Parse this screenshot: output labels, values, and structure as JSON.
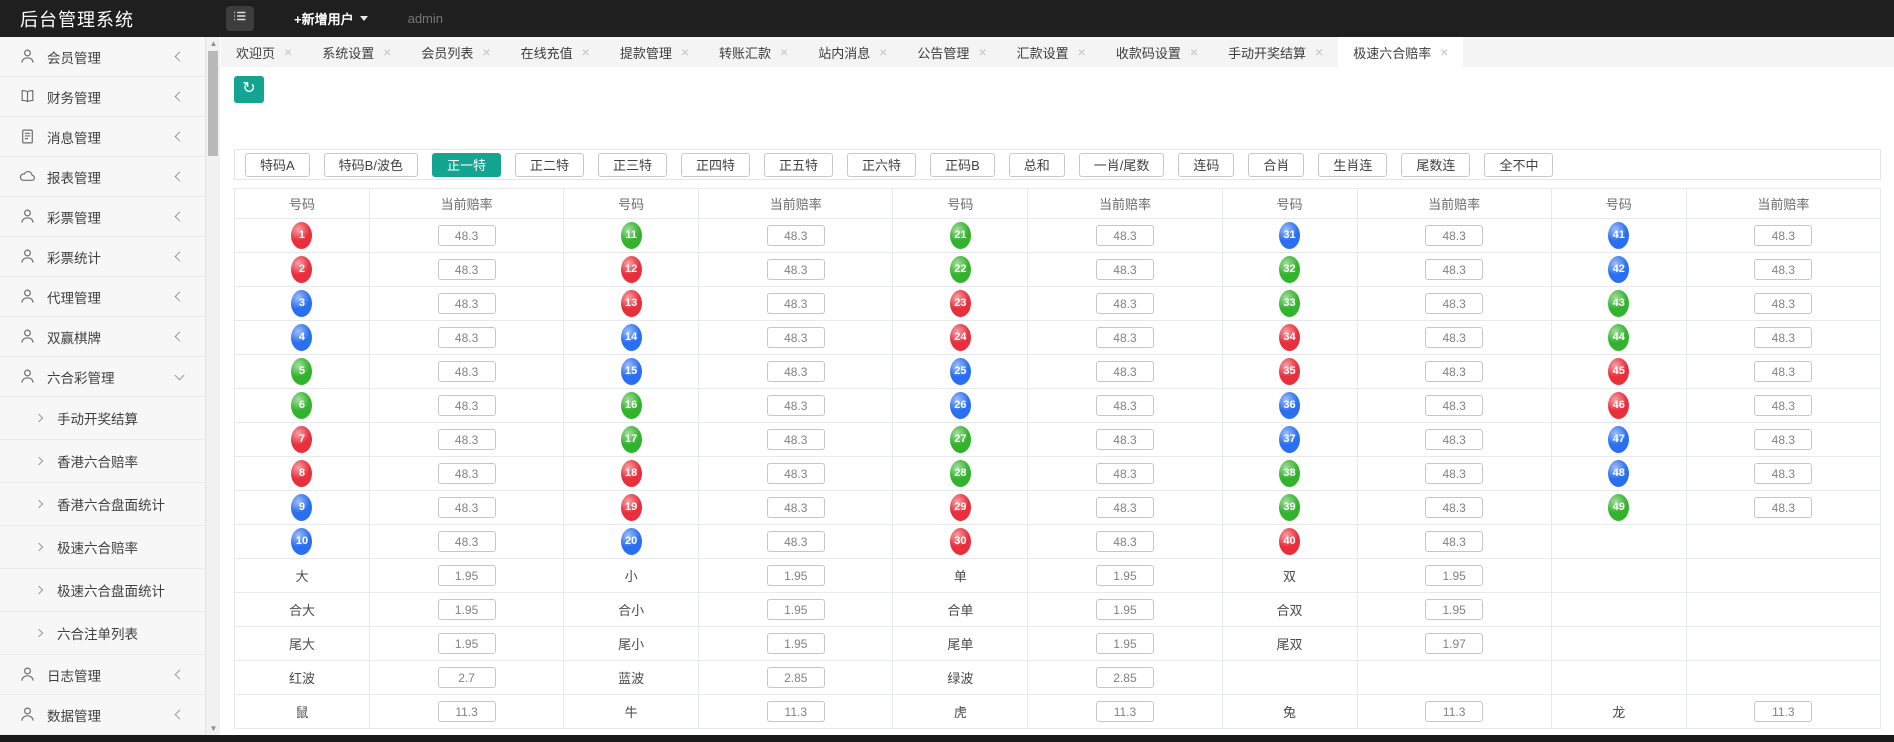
{
  "topbar": {
    "title": "后台管理系统",
    "menu_icon": "list-icon",
    "new_user_label": "+新增用户",
    "username": "admin"
  },
  "colors": {
    "accent_teal": "#14a492",
    "topbar_bg": "#1f1f1f",
    "ball_red": "#e82f3c",
    "ball_blue": "#2a6ff0",
    "ball_green": "#33b32d"
  },
  "sidebar": {
    "items": [
      {
        "icon": "user-icon",
        "label": "会员管理",
        "chevron": "left"
      },
      {
        "icon": "book-icon",
        "label": "财务管理",
        "chevron": "left"
      },
      {
        "icon": "file-icon",
        "label": "消息管理",
        "chevron": "left"
      },
      {
        "icon": "cloud-icon",
        "label": "报表管理",
        "chevron": "left"
      },
      {
        "icon": "user-icon",
        "label": "彩票管理",
        "chevron": "left"
      },
      {
        "icon": "user-icon",
        "label": "彩票统计",
        "chevron": "left"
      },
      {
        "icon": "user-icon",
        "label": "代理管理",
        "chevron": "left"
      },
      {
        "icon": "user-icon",
        "label": "双赢棋牌",
        "chevron": "left"
      },
      {
        "icon": "user-icon",
        "label": "六合彩管理",
        "chevron": "down",
        "children": [
          "手动开奖结算",
          "香港六合赔率",
          "香港六合盘面统计",
          "极速六合赔率",
          "极速六合盘面统计",
          "六合注单列表"
        ]
      },
      {
        "icon": "user-icon",
        "label": "日志管理",
        "chevron": "left"
      },
      {
        "icon": "user-icon",
        "label": "数据管理",
        "chevron": "left"
      }
    ]
  },
  "tabs": {
    "items": [
      {
        "label": "欢迎页",
        "active": false
      },
      {
        "label": "系统设置",
        "active": false
      },
      {
        "label": "会员列表",
        "active": false
      },
      {
        "label": "在线充值",
        "active": false
      },
      {
        "label": "提款管理",
        "active": false
      },
      {
        "label": "转账汇款",
        "active": false
      },
      {
        "label": "站内消息",
        "active": false
      },
      {
        "label": "公告管理",
        "active": false
      },
      {
        "label": "汇款设置",
        "active": false
      },
      {
        "label": "收款码设置",
        "active": false
      },
      {
        "label": "手动开奖结算",
        "active": false
      },
      {
        "label": "极速六合赔率",
        "active": true
      }
    ],
    "close_glyph": "×"
  },
  "toolbar": {
    "refresh_icon": "↻"
  },
  "filters": {
    "items": [
      {
        "label": "特码A",
        "active": false
      },
      {
        "label": "特码B/波色",
        "active": false
      },
      {
        "label": "正一特",
        "active": true
      },
      {
        "label": "正二特",
        "active": false
      },
      {
        "label": "正三特",
        "active": false
      },
      {
        "label": "正四特",
        "active": false
      },
      {
        "label": "正五特",
        "active": false
      },
      {
        "label": "正六特",
        "active": false
      },
      {
        "label": "正码B",
        "active": false
      },
      {
        "label": "总和",
        "active": false
      },
      {
        "label": "一肖/尾数",
        "active": false
      },
      {
        "label": "连码",
        "active": false
      },
      {
        "label": "合肖",
        "active": false
      },
      {
        "label": "生肖连",
        "active": false
      },
      {
        "label": "尾数连",
        "active": false
      },
      {
        "label": "全不中",
        "active": false
      }
    ]
  },
  "table": {
    "col_header_number": "号码",
    "col_header_odds": "当前赔率",
    "groups": 5,
    "rows": [
      {
        "cells": [
          {
            "ball": "1",
            "color": "red",
            "odds": "48.3"
          },
          {
            "ball": "11",
            "color": "green",
            "odds": "48.3"
          },
          {
            "ball": "21",
            "color": "green",
            "odds": "48.3"
          },
          {
            "ball": "31",
            "color": "blue",
            "odds": "48.3"
          },
          {
            "ball": "41",
            "color": "blue",
            "odds": "48.3"
          }
        ]
      },
      {
        "cells": [
          {
            "ball": "2",
            "color": "red",
            "odds": "48.3"
          },
          {
            "ball": "12",
            "color": "red",
            "odds": "48.3"
          },
          {
            "ball": "22",
            "color": "green",
            "odds": "48.3"
          },
          {
            "ball": "32",
            "color": "green",
            "odds": "48.3"
          },
          {
            "ball": "42",
            "color": "blue",
            "odds": "48.3"
          }
        ]
      },
      {
        "cells": [
          {
            "ball": "3",
            "color": "blue",
            "odds": "48.3"
          },
          {
            "ball": "13",
            "color": "red",
            "odds": "48.3"
          },
          {
            "ball": "23",
            "color": "red",
            "odds": "48.3"
          },
          {
            "ball": "33",
            "color": "green",
            "odds": "48.3"
          },
          {
            "ball": "43",
            "color": "green",
            "odds": "48.3"
          }
        ]
      },
      {
        "cells": [
          {
            "ball": "4",
            "color": "blue",
            "odds": "48.3"
          },
          {
            "ball": "14",
            "color": "blue",
            "odds": "48.3"
          },
          {
            "ball": "24",
            "color": "red",
            "odds": "48.3"
          },
          {
            "ball": "34",
            "color": "red",
            "odds": "48.3"
          },
          {
            "ball": "44",
            "color": "green",
            "odds": "48.3"
          }
        ]
      },
      {
        "cells": [
          {
            "ball": "5",
            "color": "green",
            "odds": "48.3"
          },
          {
            "ball": "15",
            "color": "blue",
            "odds": "48.3"
          },
          {
            "ball": "25",
            "color": "blue",
            "odds": "48.3"
          },
          {
            "ball": "35",
            "color": "red",
            "odds": "48.3"
          },
          {
            "ball": "45",
            "color": "red",
            "odds": "48.3"
          }
        ]
      },
      {
        "cells": [
          {
            "ball": "6",
            "color": "green",
            "odds": "48.3"
          },
          {
            "ball": "16",
            "color": "green",
            "odds": "48.3"
          },
          {
            "ball": "26",
            "color": "blue",
            "odds": "48.3"
          },
          {
            "ball": "36",
            "color": "blue",
            "odds": "48.3"
          },
          {
            "ball": "46",
            "color": "red",
            "odds": "48.3"
          }
        ]
      },
      {
        "cells": [
          {
            "ball": "7",
            "color": "red",
            "odds": "48.3"
          },
          {
            "ball": "17",
            "color": "green",
            "odds": "48.3"
          },
          {
            "ball": "27",
            "color": "green",
            "odds": "48.3"
          },
          {
            "ball": "37",
            "color": "blue",
            "odds": "48.3"
          },
          {
            "ball": "47",
            "color": "blue",
            "odds": "48.3"
          }
        ]
      },
      {
        "cells": [
          {
            "ball": "8",
            "color": "red",
            "odds": "48.3"
          },
          {
            "ball": "18",
            "color": "red",
            "odds": "48.3"
          },
          {
            "ball": "28",
            "color": "green",
            "odds": "48.3"
          },
          {
            "ball": "38",
            "color": "green",
            "odds": "48.3"
          },
          {
            "ball": "48",
            "color": "blue",
            "odds": "48.3"
          }
        ]
      },
      {
        "cells": [
          {
            "ball": "9",
            "color": "blue",
            "odds": "48.3"
          },
          {
            "ball": "19",
            "color": "red",
            "odds": "48.3"
          },
          {
            "ball": "29",
            "color": "red",
            "odds": "48.3"
          },
          {
            "ball": "39",
            "color": "green",
            "odds": "48.3"
          },
          {
            "ball": "49",
            "color": "green",
            "odds": "48.3"
          }
        ]
      },
      {
        "cells": [
          {
            "ball": "10",
            "color": "blue",
            "odds": "48.3"
          },
          {
            "ball": "20",
            "color": "blue",
            "odds": "48.3"
          },
          {
            "ball": "30",
            "color": "red",
            "odds": "48.3"
          },
          {
            "ball": "40",
            "color": "red",
            "odds": "48.3"
          },
          null
        ]
      },
      {
        "cells": [
          {
            "label": "大",
            "odds": "1.95"
          },
          {
            "label": "小",
            "odds": "1.95"
          },
          {
            "label": "单",
            "odds": "1.95"
          },
          {
            "label": "双",
            "odds": "1.95"
          },
          null
        ]
      },
      {
        "cells": [
          {
            "label": "合大",
            "odds": "1.95"
          },
          {
            "label": "合小",
            "odds": "1.95"
          },
          {
            "label": "合单",
            "odds": "1.95"
          },
          {
            "label": "合双",
            "odds": "1.95"
          },
          null
        ]
      },
      {
        "cells": [
          {
            "label": "尾大",
            "odds": "1.95"
          },
          {
            "label": "尾小",
            "odds": "1.95"
          },
          {
            "label": "尾单",
            "odds": "1.95"
          },
          {
            "label": "尾双",
            "odds": "1.97"
          },
          null
        ]
      },
      {
        "cells": [
          {
            "label": "红波",
            "odds": "2.7"
          },
          {
            "label": "蓝波",
            "odds": "2.85"
          },
          {
            "label": "绿波",
            "odds": "2.85"
          },
          null,
          null
        ]
      },
      {
        "cells": [
          {
            "label": "鼠",
            "odds": "11.3"
          },
          {
            "label": "牛",
            "odds": "11.3"
          },
          {
            "label": "虎",
            "odds": "11.3"
          },
          {
            "label": "兔",
            "odds": "11.3"
          },
          {
            "label": "龙",
            "odds": "11.3"
          }
        ]
      }
    ]
  }
}
